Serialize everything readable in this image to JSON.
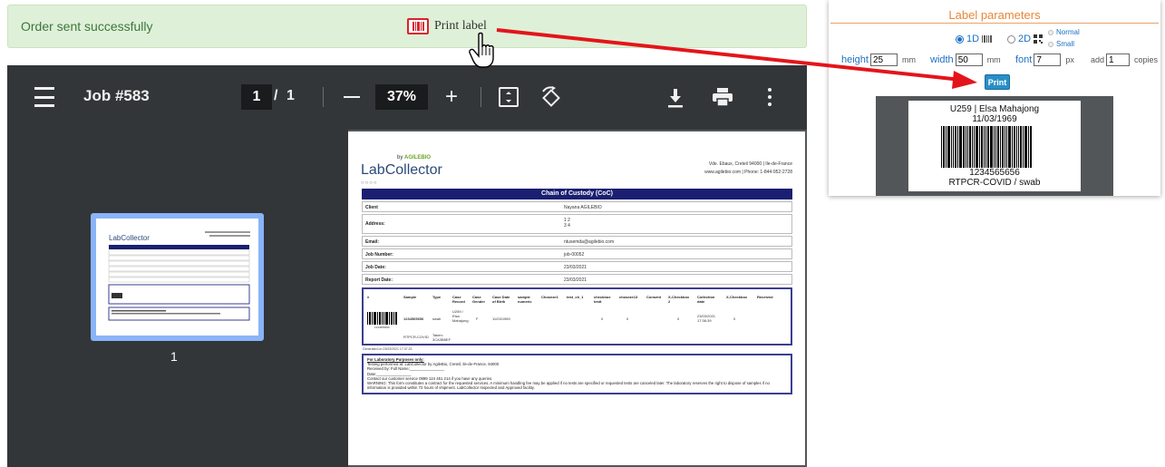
{
  "banner": {
    "message": "Order sent successfully",
    "print_label": "Print label"
  },
  "pdf_toolbar": {
    "title": "Job #583",
    "page_current": "1",
    "page_separator": "/",
    "page_total": "1",
    "zoom": "37%",
    "zoom_in": "+"
  },
  "thumbnail": {
    "number": "1"
  },
  "document": {
    "logo_by": "by",
    "logo_brand": "AGILEBIO",
    "logo_name_1": "Lab",
    "logo_name_2": "Collector",
    "address_1": "Vde. Ebaux, Creteil 94000 | Ile-de-France",
    "address_2": "www.agilebio.com | Phone: 1-844-952-2728",
    "title": "Chain of Custody (CoC)",
    "rows": [
      {
        "key": "Client",
        "value": "Nayana AGILEBIO"
      },
      {
        "key": "Address:",
        "value": "1 2 3 4"
      },
      {
        "key": "Email:",
        "value": "ntusemda@agilebio.com"
      },
      {
        "key": "Job Number:",
        "value": "job-00052"
      },
      {
        "key": "Job Date:",
        "value": "23/03/2021"
      },
      {
        "key": "Report Date:",
        "value": "23/03/2021"
      }
    ],
    "sample_headers": [
      "#",
      "Sample",
      "Type",
      "Case Record",
      "Case Gender",
      "Case Date of Birth",
      "sample numeric",
      "Choseze1",
      "test_ch_1",
      "checkbox testt",
      "choseze13",
      "Consent",
      "X-Checkbox 2",
      "Collection date",
      "X-Checkbox",
      "Received"
    ],
    "sample_row": {
      "barcode_number": "1234565656",
      "sample": "1234565656",
      "type": "swab",
      "case_record": "U259 / Elsa Mahajong",
      "gender": "F",
      "dob": "11/03/1969",
      "v1": "0",
      "v2": "0",
      "v3": "0",
      "collection": "23/03/2021 17:36:39",
      "v4": "0",
      "rt": "RTPCR-COVID",
      "taken": "Taken: 3CA3B8EF"
    },
    "generated": "Generated on 23/03/2021 17:37:23",
    "lab_title": "For Laboratory Purposes only:",
    "lab_line1": "Testing performed at: LabCollector by AgileBio, Creteil, Ile-de-France, 94000",
    "lab_line2": "Received by: Full Name:________________",
    "lab_line3": "Date:________________",
    "lab_line4": "Contact our customer service 0899 124 451 214 if you have any queries.",
    "lab_line5": "WARNING: This form constitutes a contract for the requested services. A minimum handling fee may be applied if no tests are specified or requested tests are canceled later. The laboratory reserves the right to dispose of samples if no information is provided within 72 hours of shipment. LabCollector Inspected and Approved facility."
  },
  "label_params": {
    "title": "Label parameters",
    "opt_1d": "1D",
    "opt_2d": "2D",
    "opt_normal": "Normal",
    "opt_small": "Small",
    "height_label": "height",
    "height_value": "25",
    "height_unit": "mm",
    "width_label": "width",
    "width_value": "50",
    "width_unit": "mm",
    "font_label": "font",
    "font_value": "7",
    "font_unit": "px",
    "add_label": "add",
    "add_value": "1",
    "add_unit": "copies",
    "print_button": "Print",
    "preview_line1": "U259 | Elsa Mahajong",
    "preview_line2": "11/03/1969",
    "preview_line3": "1234565656",
    "preview_line4": "RTPCR-COVID / swab"
  },
  "colors": {
    "accent_orange": "#e8873a",
    "link_blue": "#1e6fc4",
    "arrow_red": "#e3151a",
    "banner_green": "#dff0d8"
  }
}
